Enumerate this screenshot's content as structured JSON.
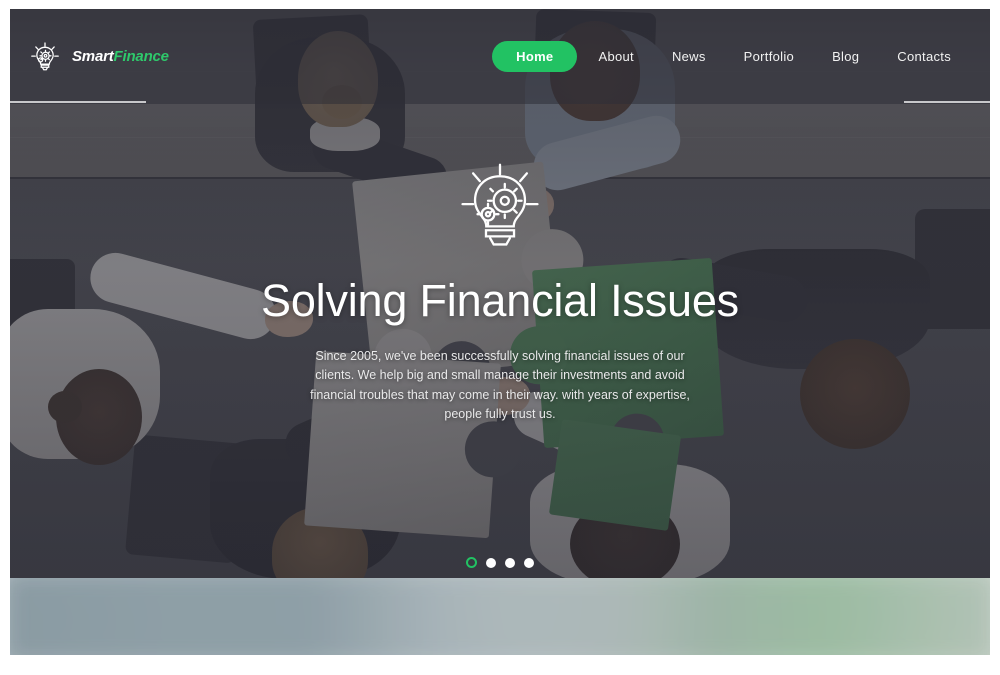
{
  "site": {
    "logo": {
      "icon": "lightbulb-gear-icon",
      "text_primary": "Smart",
      "text_accent": "Finance",
      "accent_color": "#2ec96b"
    }
  },
  "header": {
    "nav_items": [
      {
        "label": "Home",
        "active": true
      },
      {
        "label": "About",
        "active": false
      },
      {
        "label": "News",
        "active": false
      },
      {
        "label": "Portfolio",
        "active": false
      },
      {
        "label": "Blog",
        "active": false
      },
      {
        "label": "Contacts",
        "active": false
      }
    ],
    "active_pill_color": "#22c263"
  },
  "hero": {
    "icon": "lightbulb-gears-icon",
    "title": "Solving Financial Issues",
    "paragraph": "Since 2005, we've been successfully solving financial issues of our clients. We help big and small manage their investments and avoid financial troubles that may come in their way. with years of expertise, people fully trust us.",
    "background_image": "people-assembling-puzzle-pieces-on-table",
    "overlay_color": "#30303a"
  },
  "carousel": {
    "slide_count": 4,
    "active_index": 0,
    "active_dot_color": "#22c263",
    "dot_color": "#ffffff",
    "dots": [
      {
        "index": 1,
        "active": true
      },
      {
        "index": 2,
        "active": false
      },
      {
        "index": 3,
        "active": false
      },
      {
        "index": 4,
        "active": false
      }
    ]
  },
  "bottom_band": {
    "description": "blurred continuation of hero image"
  }
}
